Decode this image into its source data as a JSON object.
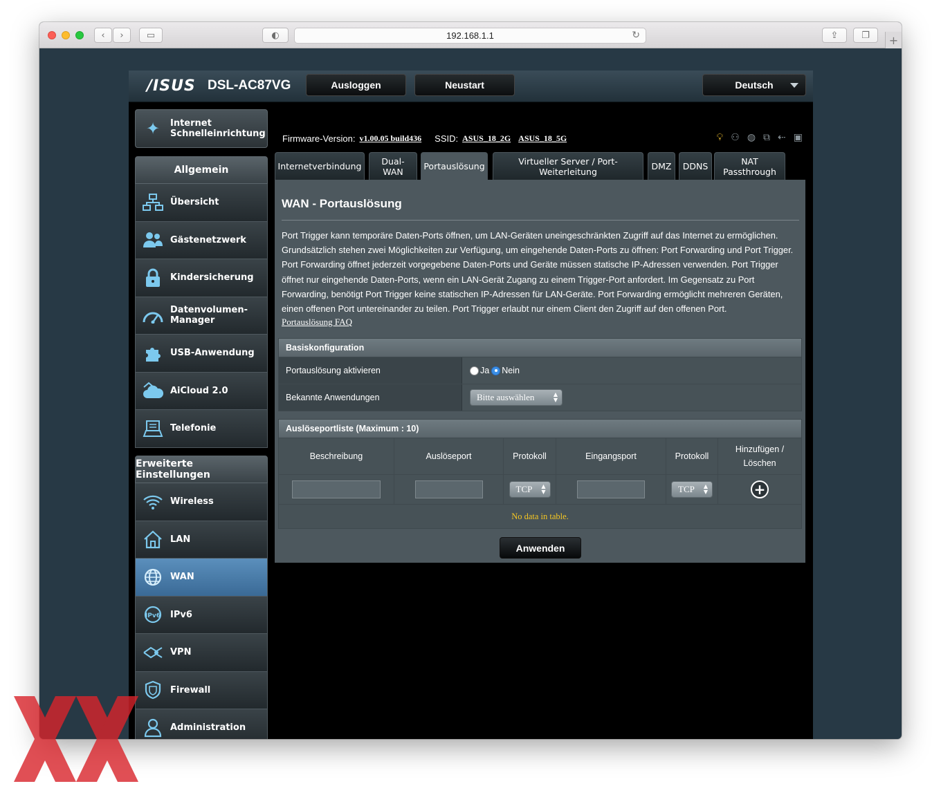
{
  "browser": {
    "url": "192.168.1.1"
  },
  "router": {
    "brand": "/ISUS",
    "model": "DSL-AC87VG",
    "buttons": {
      "logout": "Ausloggen",
      "reboot": "Neustart",
      "language": "Deutsch"
    },
    "firmware_label": "Firmware-Version:",
    "firmware_value": "v1.00.05 build436",
    "ssid_label": "SSID:",
    "ssid_1": "ASUS_18_2G",
    "ssid_2": "ASUS_18_5G",
    "status_icons": [
      "bulb-icon",
      "users-icon",
      "globe-icon",
      "network-icon",
      "usb-icon",
      "printer-icon"
    ]
  },
  "sidebar": {
    "quick_setup": "Internet\nSchnelleinrichtung",
    "general_header": "Allgemein",
    "general_items": [
      {
        "label": "Übersicht",
        "icon": "network-map-icon"
      },
      {
        "label": "Gästenetzwerk",
        "icon": "guest-users-icon"
      },
      {
        "label": "Kindersicherung",
        "icon": "lock-icon"
      },
      {
        "label": "Datenvolumen-\nManager",
        "icon": "gauge-icon"
      },
      {
        "label": "USB-Anwendung",
        "icon": "puzzle-icon"
      },
      {
        "label": "AiCloud 2.0",
        "icon": "cloud-icon"
      },
      {
        "label": "Telefonie",
        "icon": "phone-icon"
      }
    ],
    "advanced_header": "Erweiterte Einstellungen",
    "advanced_items": [
      {
        "label": "Wireless",
        "icon": "wifi-icon"
      },
      {
        "label": "LAN",
        "icon": "home-icon"
      },
      {
        "label": "WAN",
        "icon": "globe-icon",
        "active": true
      },
      {
        "label": "IPv6",
        "icon": "ipv6-icon"
      },
      {
        "label": "VPN",
        "icon": "vpn-icon"
      },
      {
        "label": "Firewall",
        "icon": "shield-icon"
      },
      {
        "label": "Administration",
        "icon": "admin-user-icon"
      }
    ]
  },
  "tabs": [
    {
      "label": "Internetverbindung"
    },
    {
      "label": "Dual-\nWAN"
    },
    {
      "label": "Portauslösung",
      "active": true
    },
    {
      "label": "Virtueller Server / Port-\nWeiterleitung"
    },
    {
      "label": "DMZ"
    },
    {
      "label": "DDNS"
    },
    {
      "label": "NAT\nPassthrough"
    }
  ],
  "page": {
    "title": "WAN - Portauslösung",
    "description": "Port Trigger kann temporäre Daten-Ports öffnen, um LAN-Geräten uneingeschränkten Zugriff auf das Internet zu ermöglichen. Grundsätzlich stehen zwei Möglichkeiten zur Verfügung, um eingehende Daten-Ports zu öffnen: Port Forwarding und Port Trigger. Port Forwarding öffnet jederzeit vorgegebene Daten-Ports und Geräte müssen statische IP-Adressen verwenden. Port Trigger öffnet nur eingehende Daten-Ports, wenn ein LAN-Gerät Zugang zu einem Trigger-Port anfordert. Im Gegensatz zu Port Forwarding, benötigt Port Trigger keine statischen IP-Adressen für LAN-Geräte. Port Forwarding ermöglicht mehreren Geräten, einen offenen Port untereinander zu teilen. Port Trigger erlaubt nur einem Client den Zugriff auf den offenen Port.",
    "faq_link": "Portauslösung FAQ",
    "basic": {
      "header": "Basiskonfiguration",
      "enable_label": "Portauslösung aktivieren",
      "yes": "Ja",
      "no": "Nein",
      "selected": "Nein",
      "apps_label": "Bekannte Anwendungen",
      "apps_value": "Bitte auswählen"
    },
    "list": {
      "header": "Auslöseportliste (Maximum : 10)",
      "columns": [
        "Beschreibung",
        "Auslöseport",
        "Protokoll",
        "Eingangsport",
        "Protokoll",
        "Hinzufügen /\nLöschen"
      ],
      "protocol_1": "TCP",
      "protocol_2": "TCP",
      "empty": "No data in table."
    },
    "apply": "Anwenden"
  }
}
